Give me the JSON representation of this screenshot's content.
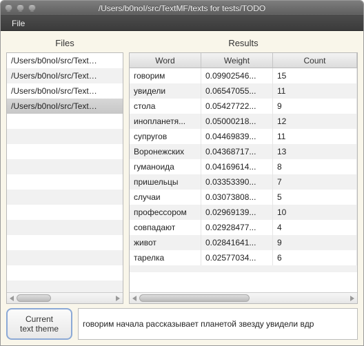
{
  "window": {
    "title": "/Users/b0noI/src/TextMF/texts for tests/TODO"
  },
  "menubar": {
    "items": [
      "File"
    ]
  },
  "panels": {
    "files": {
      "header": "Files",
      "rows": [
        "/Users/b0noI/src/Text…",
        "/Users/b0noI/src/Text…",
        "/Users/b0noI/src/Text…",
        "/Users/b0noI/src/Text…"
      ],
      "selected_index": 3
    },
    "results": {
      "header": "Results",
      "columns": {
        "word": "Word",
        "weight": "Weight",
        "count": "Count"
      },
      "rows": [
        {
          "word": "говорим",
          "weight": "0.09902546...",
          "count": "15"
        },
        {
          "word": "увидели",
          "weight": "0.06547055...",
          "count": "11"
        },
        {
          "word": "стола",
          "weight": "0.05427722...",
          "count": "9"
        },
        {
          "word": "инопланетя...",
          "weight": "0.05000218...",
          "count": "12"
        },
        {
          "word": "супругов",
          "weight": "0.04469839...",
          "count": "11"
        },
        {
          "word": "Воронежских",
          "weight": "0.04368717...",
          "count": "13"
        },
        {
          "word": "гуманоида",
          "weight": "0.04169614...",
          "count": "8"
        },
        {
          "word": "пришельцы",
          "weight": "0.03353390...",
          "count": "7"
        },
        {
          "word": "случаи",
          "weight": "0.03073808...",
          "count": "5"
        },
        {
          "word": "профессором",
          "weight": "0.02969139...",
          "count": "10"
        },
        {
          "word": "совпадают",
          "weight": "0.02928477...",
          "count": "4"
        },
        {
          "word": "живот",
          "weight": "0.02841641...",
          "count": "9"
        },
        {
          "word": "тарелка",
          "weight": "0.02577034...",
          "count": "6"
        }
      ]
    }
  },
  "bottom": {
    "button_label": "Current\ntext theme",
    "output": "говорим начала рассказывает планетой звезду увидели вдр"
  }
}
